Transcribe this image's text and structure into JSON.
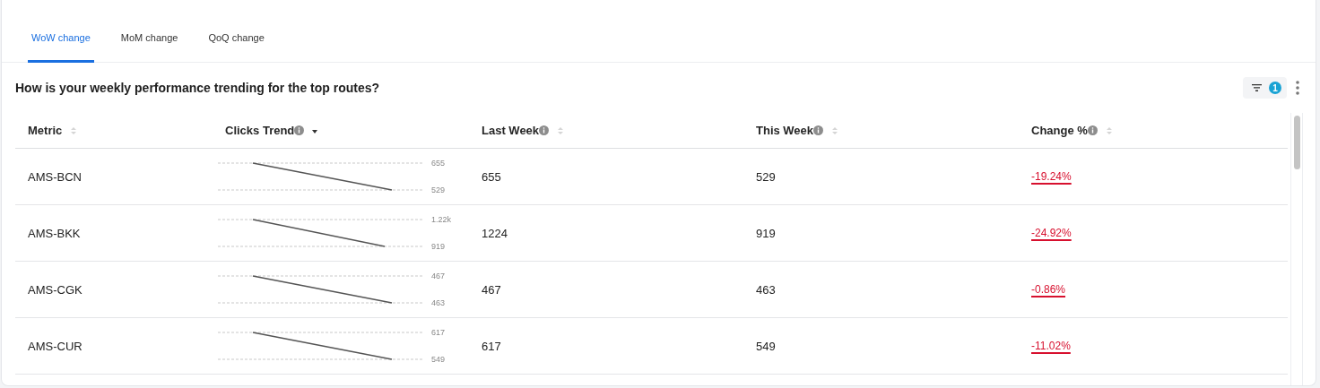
{
  "tabs": [
    {
      "label": "WoW change",
      "selected": true
    },
    {
      "label": "MoM change",
      "selected": false
    },
    {
      "label": "QoQ change",
      "selected": false
    }
  ],
  "title": "How is your weekly performance trending for the top routes?",
  "filter": {
    "count": "1"
  },
  "table": {
    "columns": [
      {
        "label": "Metric",
        "info": false,
        "sorted_descending": false
      },
      {
        "label": "Clicks Trend",
        "info": true,
        "sorted_descending": true
      },
      {
        "label": "Last Week",
        "info": true,
        "sorted_descending": false
      },
      {
        "label": "This Week",
        "info": true,
        "sorted_descending": false
      },
      {
        "label": "Change %",
        "info": true,
        "sorted_descending": false
      }
    ],
    "rows": [
      {
        "metric": "AMS-BCN",
        "trend": {
          "high": "655",
          "low": "529",
          "falling": true
        },
        "last_week": "655",
        "this_week": "529",
        "change": "-19.24%"
      },
      {
        "metric": "AMS-BKK",
        "trend": {
          "high": "1.22k",
          "low": "919",
          "falling": true
        },
        "last_week": "1224",
        "this_week": "919",
        "change": "-24.92%"
      },
      {
        "metric": "AMS-CGK",
        "trend": {
          "high": "467",
          "low": "463",
          "falling": true
        },
        "last_week": "467",
        "this_week": "463",
        "change": "-0.86%"
      },
      {
        "metric": "AMS-CUR",
        "trend": {
          "high": "617",
          "low": "549",
          "falling": true
        },
        "last_week": "617",
        "this_week": "549",
        "change": "-11.02%"
      }
    ]
  }
}
